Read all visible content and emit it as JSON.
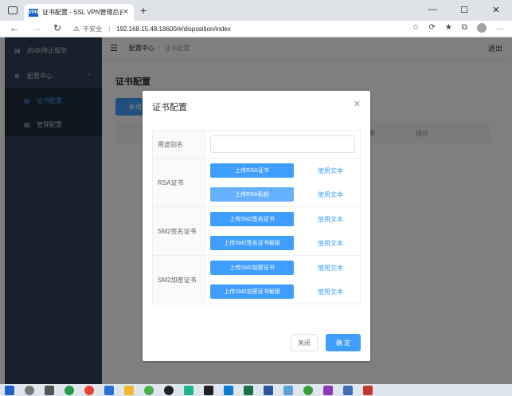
{
  "browser": {
    "tab_title": "证书配置 - SSL VPN管理后台",
    "favicon_text": "VPN",
    "url_warning": "不安全",
    "url": "192.168.15.48:18600/#/disposition/index"
  },
  "sidebar": {
    "items": [
      {
        "label": "启动/停止服务",
        "icon": "document-icon"
      },
      {
        "label": "配置中心",
        "icon": "plus-circle-icon",
        "caret": "^"
      },
      {
        "label": "证书配置",
        "icon": "list-icon",
        "active": true
      },
      {
        "label": "管理配置",
        "icon": "document-icon"
      }
    ]
  },
  "header": {
    "breadcrumb": [
      "配置中心",
      "证书配置"
    ],
    "logout": "退出"
  },
  "page": {
    "title": "证书配置",
    "new_button": "新增",
    "table_headers": [
      "書",
      "操作"
    ]
  },
  "dialog": {
    "title": "证书配置",
    "alias_label": "用途别名",
    "alias_value": "",
    "groups": [
      {
        "label": "RSA证书",
        "rows": [
          {
            "button": "上传RSA证书",
            "link": "使用文本",
            "light": false
          },
          {
            "button": "上传RSA私钥",
            "link": "使用文本",
            "light": true
          }
        ]
      },
      {
        "label": "SM2签名证书",
        "rows": [
          {
            "button": "上传SM2签名证书",
            "link": "使用文本",
            "light": false
          },
          {
            "button": "上传SM2签名证书秘钥",
            "link": "使用文本",
            "light": false
          }
        ]
      },
      {
        "label": "SM2加密证书",
        "rows": [
          {
            "button": "上传SM2加密证书",
            "link": "使用文本",
            "light": false
          },
          {
            "button": "上传SM2加密证书秘钥",
            "link": "使用文本",
            "light": false
          }
        ]
      }
    ],
    "cancel": "关闭",
    "confirm": "确 定"
  },
  "colors": {
    "primary": "#409eff",
    "sidebar_bg": "#304156"
  }
}
